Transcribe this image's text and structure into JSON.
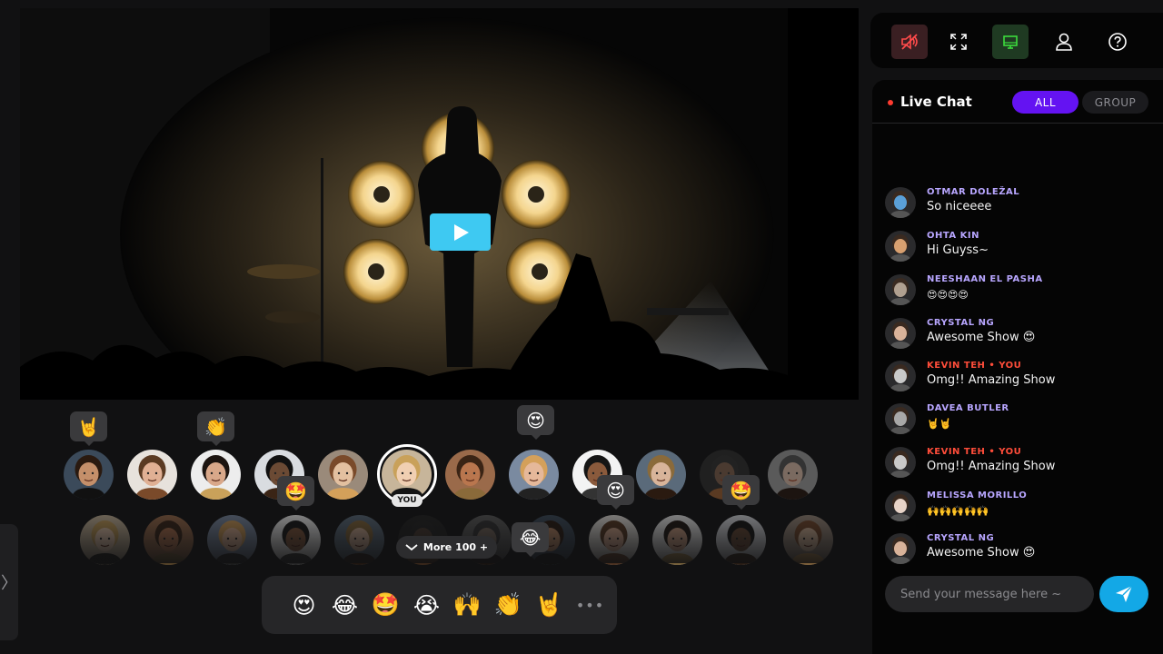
{
  "video": {
    "play_icon": "play-icon"
  },
  "audience": {
    "you_label": "YOU",
    "more_label": "More 100 +",
    "more_icon": "chevron-down-icon",
    "bubbles": [
      {
        "emoji": "🤘"
      },
      {
        "emoji": "👏"
      },
      {
        "emoji": "😍"
      },
      {
        "emoji": "🤩"
      },
      {
        "emoji": "😍"
      },
      {
        "emoji": "🤩"
      },
      {
        "emoji": "😂"
      }
    ]
  },
  "reactions": {
    "items": [
      "😍",
      "😂",
      "🤩",
      "😭",
      "🙌",
      "👏",
      "🤘"
    ],
    "more": "•••"
  },
  "side_handle": {
    "icon": "chevron-right-icon",
    "glyph": "〉"
  },
  "toolbar": {
    "items": [
      {
        "name": "mute-button",
        "icon": "speaker-muted-icon",
        "color": "#ff4b4b"
      },
      {
        "name": "fullscreen-button",
        "icon": "fullscreen-icon",
        "color": "#ffffff"
      },
      {
        "name": "screen-button",
        "icon": "screen-icon",
        "color": "#3ddb3d"
      },
      {
        "name": "profile-button",
        "icon": "user-icon",
        "color": "#ffffff"
      },
      {
        "name": "help-button",
        "icon": "help-icon",
        "color": "#ffffff"
      }
    ]
  },
  "chat": {
    "title": "Live Chat",
    "tabs": [
      "ALL",
      "GROUP"
    ],
    "messages": [
      {
        "name": "OTMAR DOLEŽAL",
        "text": "So niceeee",
        "me": false
      },
      {
        "name": "OHTA KIN",
        "text": "Hi Guyss~",
        "me": false
      },
      {
        "name": "NEESHAAN EL PASHA",
        "text": "😍😍😍😍",
        "me": false
      },
      {
        "name": "CRYSTAL NG",
        "text": "Awesome Show 😍",
        "me": false
      },
      {
        "name": "KEVIN TEH • YOU",
        "text": "Omg!! Amazing Show",
        "me": true
      },
      {
        "name": "DAVEA BUTLER",
        "text": "🤘🤘",
        "me": false
      },
      {
        "name": "KEVIN TEH • YOU",
        "text": "Omg!! Amazing Show",
        "me": true
      },
      {
        "name": "MELISSA MORILLO",
        "text": "🙌🙌🙌🙌🙌",
        "me": false
      },
      {
        "name": "CRYSTAL NG",
        "text": "Awesome Show 😍",
        "me": false
      }
    ],
    "input_placeholder": "Send your message here ~",
    "send_icon": "send-icon"
  },
  "colors": {
    "accent": "#6413f2",
    "send": "#13a8e6",
    "play": "#3ec9f2",
    "self_name": "#ff4d3a",
    "user_name": "#b8a6ff"
  }
}
